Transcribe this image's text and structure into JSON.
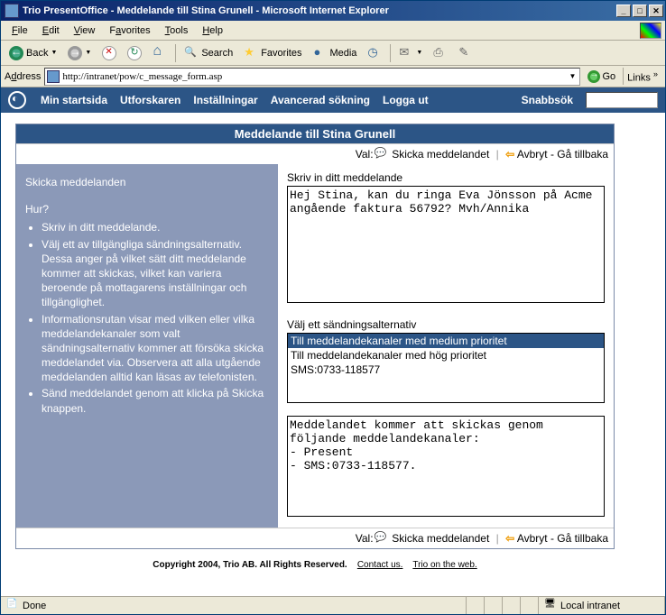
{
  "window": {
    "title": "Trio PresentOffice - Meddelande till Stina Grunell - Microsoft Internet Explorer",
    "min": "_",
    "max": "□",
    "close": "✕"
  },
  "menubar": {
    "file": "File",
    "edit": "Edit",
    "view": "View",
    "favorites": "Favorites",
    "tools": "Tools",
    "help": "Help"
  },
  "toolbar": {
    "back": "Back",
    "search": "Search",
    "favorites": "Favorites",
    "media": "Media"
  },
  "addressbar": {
    "label": "Address",
    "url": "http://intranet/pow/c_message_form.asp",
    "go": "Go",
    "links": "Links"
  },
  "appnav": {
    "items": [
      "Min startsida",
      "Utforskaren",
      "Inställningar",
      "Avancerad sökning",
      "Logga ut"
    ],
    "snabbsok": "Snabbsök"
  },
  "panel": {
    "title": "Meddelande till Stina Grunell",
    "val_label": "Val:",
    "send": "Skicka meddelandet",
    "cancel": "Avbryt - Gå tillbaka"
  },
  "help": {
    "heading": "Skicka meddelanden",
    "hur": "Hur?",
    "items": [
      "Skriv in ditt meddelande.",
      "Välj ett av tillgängliga sändningsalternativ. Dessa anger på vilket sätt ditt meddelande kommer att skickas, vilket kan variera beroende på mottagarens inställningar och tillgänglighet.",
      "Informationsrutan visar med vilken eller vilka meddelandekanaler som valt sändningsalternativ kommer att försöka skicka meddelandet via. Observera att alla utgående meddelanden alltid kan läsas av telefonisten.",
      "Sänd meddelandet genom att klicka på Skicka knappen."
    ]
  },
  "form": {
    "msg_label": "Skriv in ditt meddelande",
    "msg_value": "Hej Stina, kan du ringa Eva Jönsson på Acme angående faktura 56792? Mvh/Annika",
    "alt_label": "Välj ett sändningsalternativ",
    "alts": [
      "Till meddelandekanaler med medium prioritet",
      "Till meddelandekanaler med hög prioritet",
      "SMS:0733-118577"
    ],
    "alt_selected": 0,
    "info_value": "Meddelandet kommer att skickas genom följande meddelandekanaler:\n- Present\n- SMS:0733-118577."
  },
  "footer": {
    "copyright": "Copyright 2004, Trio AB. All Rights Reserved.",
    "contact": "Contact us.",
    "web": "Trio on the web."
  },
  "statusbar": {
    "done": "Done",
    "zone": "Local intranet"
  }
}
